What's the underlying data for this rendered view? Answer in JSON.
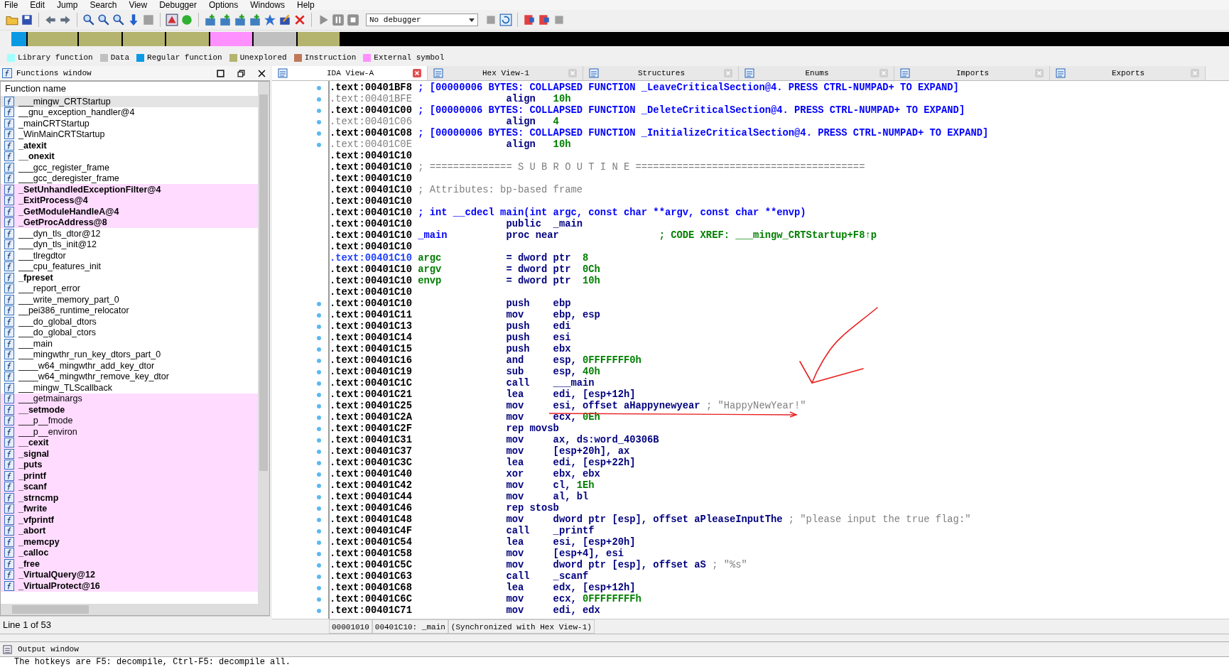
{
  "menu": [
    "File",
    "Edit",
    "Jump",
    "Search",
    "View",
    "Debugger",
    "Options",
    "Windows",
    "Help"
  ],
  "debugger_select": {
    "value": "No debugger"
  },
  "legend": [
    {
      "label": "Library function",
      "color": "#a0ffff"
    },
    {
      "label": "Data",
      "color": "#c0c0c0"
    },
    {
      "label": "Regular function",
      "color": "#0a9ae4"
    },
    {
      "label": "Unexplored",
      "color": "#b4b46e"
    },
    {
      "label": "Instruction",
      "color": "#c0785a"
    },
    {
      "label": "External symbol",
      "color": "#ff90ff"
    }
  ],
  "functions_window": {
    "title": "Functions window",
    "column": "Function name",
    "status": "Line 1 of 53",
    "items": [
      {
        "name": "___mingw_CRTStartup",
        "bold": false,
        "imported": false,
        "selected": true
      },
      {
        "name": "__gnu_exception_handler@4",
        "bold": false,
        "imported": false,
        "selected": false
      },
      {
        "name": "_mainCRTStartup",
        "bold": false,
        "imported": false,
        "selected": false
      },
      {
        "name": "_WinMainCRTStartup",
        "bold": false,
        "imported": false,
        "selected": false
      },
      {
        "name": "_atexit",
        "bold": true,
        "imported": false,
        "selected": false
      },
      {
        "name": "__onexit",
        "bold": true,
        "imported": false,
        "selected": false
      },
      {
        "name": "___gcc_register_frame",
        "bold": false,
        "imported": false,
        "selected": false
      },
      {
        "name": "___gcc_deregister_frame",
        "bold": false,
        "imported": false,
        "selected": false
      },
      {
        "name": "_SetUnhandledExceptionFilter@4",
        "bold": true,
        "imported": true,
        "selected": false
      },
      {
        "name": "_ExitProcess@4",
        "bold": true,
        "imported": true,
        "selected": false
      },
      {
        "name": "_GetModuleHandleA@4",
        "bold": true,
        "imported": true,
        "selected": false
      },
      {
        "name": "_GetProcAddress@8",
        "bold": true,
        "imported": true,
        "selected": false
      },
      {
        "name": "___dyn_tls_dtor@12",
        "bold": false,
        "imported": false,
        "selected": false
      },
      {
        "name": "___dyn_tls_init@12",
        "bold": false,
        "imported": false,
        "selected": false
      },
      {
        "name": "___tlregdtor",
        "bold": false,
        "imported": false,
        "selected": false
      },
      {
        "name": "___cpu_features_init",
        "bold": false,
        "imported": false,
        "selected": false
      },
      {
        "name": "_fpreset",
        "bold": true,
        "imported": false,
        "selected": false
      },
      {
        "name": "___report_error",
        "bold": false,
        "imported": false,
        "selected": false
      },
      {
        "name": "___write_memory_part_0",
        "bold": false,
        "imported": false,
        "selected": false
      },
      {
        "name": "__pei386_runtime_relocator",
        "bold": false,
        "imported": false,
        "selected": false
      },
      {
        "name": "___do_global_dtors",
        "bold": false,
        "imported": false,
        "selected": false
      },
      {
        "name": "___do_global_ctors",
        "bold": false,
        "imported": false,
        "selected": false
      },
      {
        "name": "___main",
        "bold": false,
        "imported": false,
        "selected": false
      },
      {
        "name": "___mingwthr_run_key_dtors_part_0",
        "bold": false,
        "imported": false,
        "selected": false
      },
      {
        "name": "____w64_mingwthr_add_key_dtor",
        "bold": false,
        "imported": false,
        "selected": false
      },
      {
        "name": "____w64_mingwthr_remove_key_dtor",
        "bold": false,
        "imported": false,
        "selected": false
      },
      {
        "name": "___mingw_TLScallback",
        "bold": false,
        "imported": false,
        "selected": false
      },
      {
        "name": "___getmainargs",
        "bold": false,
        "imported": true,
        "selected": false
      },
      {
        "name": "__setmode",
        "bold": true,
        "imported": true,
        "selected": false
      },
      {
        "name": "___p__fmode",
        "bold": false,
        "imported": true,
        "selected": false
      },
      {
        "name": "___p__environ",
        "bold": false,
        "imported": true,
        "selected": false
      },
      {
        "name": "__cexit",
        "bold": true,
        "imported": true,
        "selected": false
      },
      {
        "name": "_signal",
        "bold": true,
        "imported": true,
        "selected": false
      },
      {
        "name": "_puts",
        "bold": true,
        "imported": true,
        "selected": false
      },
      {
        "name": "_printf",
        "bold": true,
        "imported": true,
        "selected": false
      },
      {
        "name": "_scanf",
        "bold": true,
        "imported": true,
        "selected": false
      },
      {
        "name": "_strncmp",
        "bold": true,
        "imported": true,
        "selected": false
      },
      {
        "name": "_fwrite",
        "bold": true,
        "imported": true,
        "selected": false
      },
      {
        "name": "_vfprintf",
        "bold": true,
        "imported": true,
        "selected": false
      },
      {
        "name": "_abort",
        "bold": true,
        "imported": true,
        "selected": false
      },
      {
        "name": "_memcpy",
        "bold": true,
        "imported": true,
        "selected": false
      },
      {
        "name": "_calloc",
        "bold": true,
        "imported": true,
        "selected": false
      },
      {
        "name": "_free",
        "bold": true,
        "imported": true,
        "selected": false
      },
      {
        "name": "_VirtualQuery@12",
        "bold": true,
        "imported": true,
        "selected": false
      },
      {
        "name": "_VirtualProtect@16",
        "bold": true,
        "imported": true,
        "selected": false
      }
    ]
  },
  "tabs": [
    {
      "label": "IDA View-A",
      "selected": true
    },
    {
      "label": "Hex View-1",
      "selected": false
    },
    {
      "label": "Structures",
      "selected": false
    },
    {
      "label": "Enums",
      "selected": false
    },
    {
      "label": "Imports",
      "selected": false
    },
    {
      "label": "Exports",
      "selected": false
    }
  ],
  "listing": [
    {
      "kind": "collapsed",
      "address": ".text:00401BF8",
      "dot": true,
      "comment": "; [00000006 BYTES: COLLAPSED FUNCTION _LeaveCriticalSection@4. PRESS CTRL-NUMPAD+ TO EXPAND]"
    },
    {
      "kind": "align",
      "address": ".text:00401BFE",
      "dot": true,
      "mnem": "align",
      "num": "10h"
    },
    {
      "kind": "collapsed",
      "address": ".text:00401C00",
      "dot": true,
      "comment": "; [00000006 BYTES: COLLAPSED FUNCTION _DeleteCriticalSection@4. PRESS CTRL-NUMPAD+ TO EXPAND]"
    },
    {
      "kind": "align",
      "address": ".text:00401C06",
      "dot": true,
      "mnem": "align",
      "num": "4"
    },
    {
      "kind": "collapsed",
      "address": ".text:00401C08",
      "dot": true,
      "comment": "; [00000006 BYTES: COLLAPSED FUNCTION _InitializeCriticalSection@4. PRESS CTRL-NUMPAD+ TO EXPAND]"
    },
    {
      "kind": "align",
      "address": ".text:00401C0E",
      "dot": true,
      "mnem": "align",
      "num": "10h"
    },
    {
      "kind": "blank",
      "address": ".text:00401C10",
      "dot": false
    },
    {
      "kind": "note",
      "address": ".text:00401C10",
      "dot": false,
      "comment": "; ============== S U B R O U T I N E ======================================="
    },
    {
      "kind": "blank",
      "address": ".text:00401C10",
      "dot": false
    },
    {
      "kind": "note",
      "address": ".text:00401C10",
      "dot": false,
      "comment": "; Attributes: bp-based frame"
    },
    {
      "kind": "blank",
      "address": ".text:00401C10",
      "dot": false
    },
    {
      "kind": "proto",
      "address": ".text:00401C10",
      "dot": false,
      "comment": "; int __cdecl main(int argc, const char **argv, const char **envp)"
    },
    {
      "kind": "code",
      "address": ".text:00401C10",
      "dot": false,
      "mnem": "public",
      "ops": "_main"
    },
    {
      "kind": "xref",
      "address": ".text:00401C10",
      "dot": false,
      "label": "_main",
      "mnem": "proc near",
      "comment": "; CODE XREF: ___mingw_CRTStartup+F8↑p"
    },
    {
      "kind": "blank",
      "address": ".text:00401C10",
      "dot": false
    },
    {
      "kind": "var",
      "address": ".text:00401C10",
      "dot": false,
      "cursor": true,
      "label": "argc",
      "mnem": "= dword ptr",
      "num": "8"
    },
    {
      "kind": "var",
      "address": ".text:00401C10",
      "dot": false,
      "label": "argv",
      "mnem": "= dword ptr",
      "num": "0Ch"
    },
    {
      "kind": "var",
      "address": ".text:00401C10",
      "dot": false,
      "label": "envp",
      "mnem": "= dword ptr",
      "num": "10h"
    },
    {
      "kind": "blank",
      "address": ".text:00401C10",
      "dot": false
    },
    {
      "kind": "code",
      "address": ".text:00401C10",
      "dot": true,
      "mnem": "push",
      "ops": "ebp"
    },
    {
      "kind": "code",
      "address": ".text:00401C11",
      "dot": true,
      "mnem": "mov",
      "ops": "ebp, esp"
    },
    {
      "kind": "code",
      "address": ".text:00401C13",
      "dot": true,
      "mnem": "push",
      "ops": "edi"
    },
    {
      "kind": "code",
      "address": ".text:00401C14",
      "dot": true,
      "mnem": "push",
      "ops": "esi"
    },
    {
      "kind": "code",
      "address": ".text:00401C15",
      "dot": true,
      "mnem": "push",
      "ops": "ebx"
    },
    {
      "kind": "code",
      "address": ".text:00401C16",
      "dot": true,
      "mnem": "and",
      "ops": "esp, ",
      "num": "0FFFFFFF0h"
    },
    {
      "kind": "code",
      "address": ".text:00401C19",
      "dot": true,
      "mnem": "sub",
      "ops": "esp, ",
      "num": "40h"
    },
    {
      "kind": "code",
      "address": ".text:00401C1C",
      "dot": true,
      "mnem": "call",
      "ops": "___main"
    },
    {
      "kind": "code",
      "address": ".text:00401C21",
      "dot": true,
      "mnem": "lea",
      "ops": "edi, [esp+12h]"
    },
    {
      "kind": "code",
      "address": ".text:00401C25",
      "dot": true,
      "mnem": "mov",
      "ops": "esi, offset aHappynewyear",
      "comment": "; \"HappyNewYear!\""
    },
    {
      "kind": "code",
      "address": ".text:00401C2A",
      "dot": true,
      "mnem": "mov",
      "ops": "ecx, ",
      "num": "0Eh"
    },
    {
      "kind": "code",
      "address": ".text:00401C2F",
      "dot": true,
      "mnem": "rep movsb"
    },
    {
      "kind": "code",
      "address": ".text:00401C31",
      "dot": true,
      "mnem": "mov",
      "ops": "ax, ds:word_40306B"
    },
    {
      "kind": "code",
      "address": ".text:00401C37",
      "dot": true,
      "mnem": "mov",
      "ops": "[esp+20h], ax"
    },
    {
      "kind": "code",
      "address": ".text:00401C3C",
      "dot": true,
      "mnem": "lea",
      "ops": "edi, [esp+22h]"
    },
    {
      "kind": "code",
      "address": ".text:00401C40",
      "dot": true,
      "mnem": "xor",
      "ops": "ebx, ebx"
    },
    {
      "kind": "code",
      "address": ".text:00401C42",
      "dot": true,
      "mnem": "mov",
      "ops": "cl, ",
      "num": "1Eh"
    },
    {
      "kind": "code",
      "address": ".text:00401C44",
      "dot": true,
      "mnem": "mov",
      "ops": "al, bl"
    },
    {
      "kind": "code",
      "address": ".text:00401C46",
      "dot": true,
      "mnem": "rep stosb"
    },
    {
      "kind": "code",
      "address": ".text:00401C48",
      "dot": true,
      "mnem": "mov",
      "ops": "dword ptr [esp], offset aPleaseInputThe",
      "comment": "; \"please input the true flag:\""
    },
    {
      "kind": "code",
      "address": ".text:00401C4F",
      "dot": true,
      "mnem": "call",
      "ops": "_printf"
    },
    {
      "kind": "code",
      "address": ".text:00401C54",
      "dot": true,
      "mnem": "lea",
      "ops": "esi, [esp+20h]"
    },
    {
      "kind": "code",
      "address": ".text:00401C58",
      "dot": true,
      "mnem": "mov",
      "ops": "[esp+4], esi"
    },
    {
      "kind": "code",
      "address": ".text:00401C5C",
      "dot": true,
      "mnem": "mov",
      "ops": "dword ptr [esp], offset aS",
      "comment": "; \"%s\""
    },
    {
      "kind": "code",
      "address": ".text:00401C63",
      "dot": true,
      "mnem": "call",
      "ops": "_scanf"
    },
    {
      "kind": "code",
      "address": ".text:00401C68",
      "dot": true,
      "mnem": "lea",
      "ops": "edx, [esp+12h]"
    },
    {
      "kind": "code",
      "address": ".text:00401C6C",
      "dot": true,
      "mnem": "mov",
      "ops": "ecx, ",
      "num": "0FFFFFFFFh"
    },
    {
      "kind": "code",
      "address": ".text:00401C71",
      "dot": true,
      "mnem": "mov",
      "ops": "edi, edx"
    }
  ],
  "listing_status": [
    "00001010",
    "00401C10: _main",
    "(Synchronized with Hex View-1)"
  ],
  "output_window": {
    "title": "Output window",
    "text": "The hotkeys are F5: decompile, Ctrl-F5: decompile all."
  }
}
